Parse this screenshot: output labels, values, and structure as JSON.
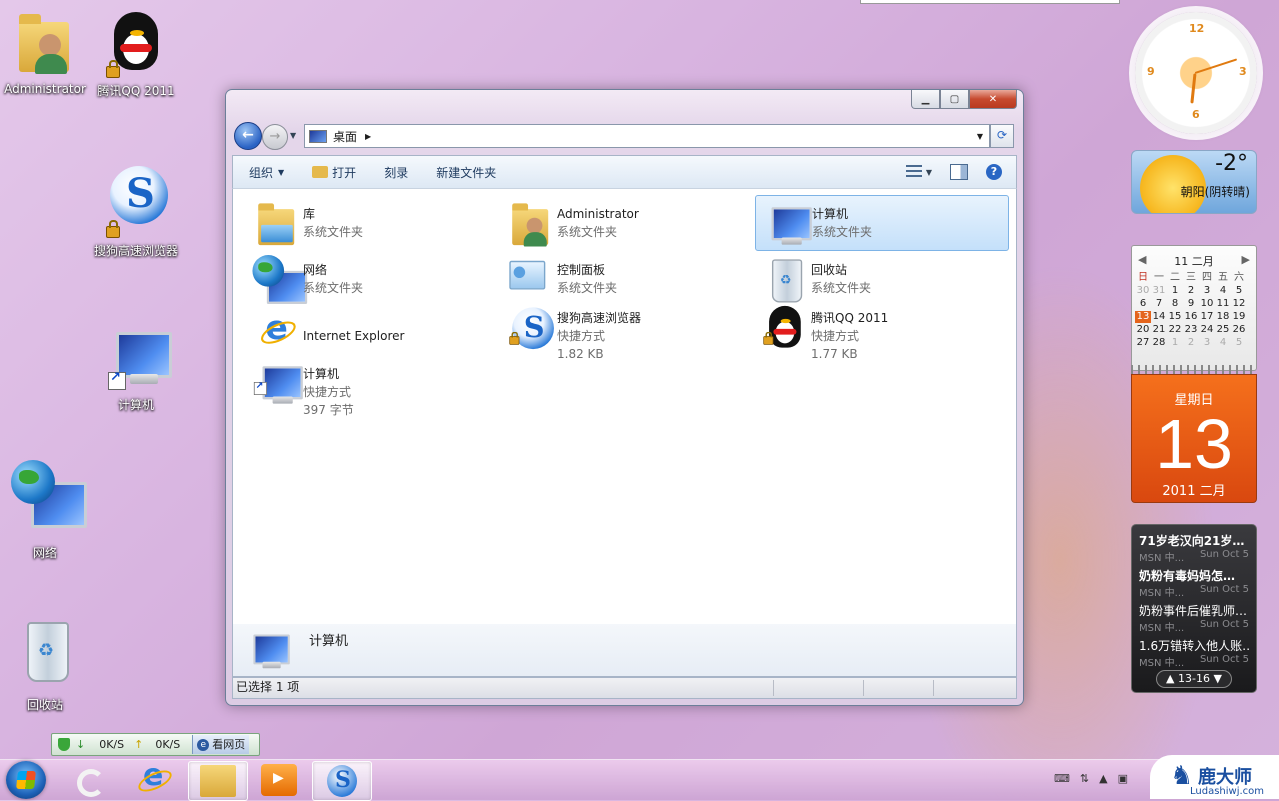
{
  "desktop": {
    "icons": [
      {
        "label": "Administrator"
      },
      {
        "label": "腾讯QQ 2011"
      },
      {
        "label": "搜狗高速浏览器"
      },
      {
        "label": "计算机"
      },
      {
        "label": "网络"
      },
      {
        "label": "回收站"
      }
    ]
  },
  "window": {
    "address": {
      "location": "桌面"
    },
    "toolbar": {
      "organize": "组织",
      "open": "打开",
      "burn": "刻录",
      "new_folder": "新建文件夹"
    },
    "items": [
      {
        "name": "库",
        "line2": "系统文件夹",
        "line3": ""
      },
      {
        "name": "Administrator",
        "line2": "系统文件夹",
        "line3": ""
      },
      {
        "name": "计算机",
        "line2": "系统文件夹",
        "line3": "",
        "selected": true
      },
      {
        "name": "网络",
        "line2": "系统文件夹",
        "line3": ""
      },
      {
        "name": "控制面板",
        "line2": "系统文件夹",
        "line3": ""
      },
      {
        "name": "回收站",
        "line2": "系统文件夹",
        "line3": ""
      },
      {
        "name": "Internet Explorer",
        "line2": "",
        "line3": ""
      },
      {
        "name": "搜狗高速浏览器",
        "line2": "快捷方式",
        "line3": "1.82 KB"
      },
      {
        "name": "腾讯QQ 2011",
        "line2": "快捷方式",
        "line3": "1.77 KB"
      },
      {
        "name": "计算机",
        "line2": "快捷方式",
        "line3": "397 字节"
      }
    ],
    "details": {
      "name": "计算机"
    },
    "status": "已选择 1 项"
  },
  "gadgets": {
    "clock": {
      "numerals": [
        "12",
        "3",
        "6",
        "9"
      ],
      "hour": 6,
      "minute": 12
    },
    "weather": {
      "temp": "-2°",
      "desc": "朝阳(阴转晴)"
    },
    "calendar": {
      "month_label": "11 二月",
      "weekdays": [
        "日",
        "一",
        "二",
        "三",
        "四",
        "五",
        "六"
      ],
      "days": [
        [
          "30",
          "31",
          "1",
          "2",
          "3",
          "4",
          "5"
        ],
        [
          "6",
          "7",
          "8",
          "9",
          "10",
          "11",
          "12"
        ],
        [
          "13",
          "14",
          "15",
          "16",
          "17",
          "18",
          "19"
        ],
        [
          "20",
          "21",
          "22",
          "23",
          "24",
          "25",
          "26"
        ],
        [
          "27",
          "28",
          "1",
          "2",
          "3",
          "4",
          "5"
        ]
      ],
      "today": "13"
    },
    "bigdate": {
      "weekday": "星期日",
      "day": "13",
      "year_month": "2011 二月"
    },
    "news": {
      "items": [
        {
          "headline": "71岁老汉向21岁…",
          "source": "MSN 中...",
          "date": "Sun Oct 5"
        },
        {
          "headline": "奶粉有毒妈妈怎…",
          "source": "MSN 中...",
          "date": "Sun Oct 5"
        },
        {
          "headline": "奶粉事件后催乳师…",
          "source": "MSN 中...",
          "date": "Sun Oct 5"
        },
        {
          "headline": "1.6万错转入他人账…",
          "source": "MSN 中...",
          "date": "Sun Oct 5"
        }
      ],
      "pager": "13-16"
    }
  },
  "netspeed": {
    "down": "0K/S",
    "up": "0K/S",
    "browse": "看网页"
  },
  "brand": {
    "name": "鹿大师",
    "url": "Ludashiwj.com"
  }
}
